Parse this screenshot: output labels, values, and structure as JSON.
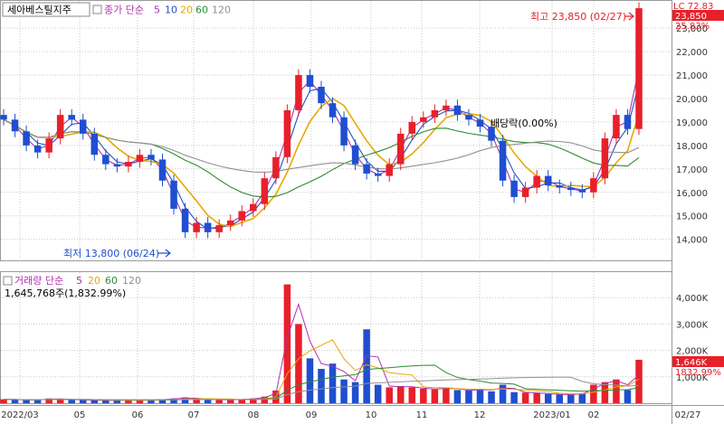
{
  "header": {
    "stock_name": "세아베스틸지주",
    "price_ma_label": "종가 단순",
    "ma_periods": [
      "5",
      "10",
      "20",
      "60",
      "120"
    ],
    "volume_label": "거래량 단순",
    "volume_ma_periods": [
      "5",
      "20",
      "60",
      "120"
    ],
    "volume_value_text": "1,645,768주(1,832.99%)"
  },
  "colors": {
    "up": "#e8202a",
    "down": "#1f4fd0",
    "ma5": "#b030b0",
    "ma10": "#2050c0",
    "ma20": "#e8a800",
    "ma60": "#2e8b2e",
    "ma120": "#909090",
    "grid": "#c8c8c8",
    "axis_text": "#333333"
  },
  "annotations": {
    "high_label": "최고 23,850 (02/27)",
    "low_label": "최저 13,800 (06/24)",
    "dividend_label": "배당락(0.00%)"
  },
  "right_labels": {
    "lc_label": "LC 72.83",
    "price_badge": "23,850",
    "price_pct": "25.83%",
    "volume_badge": "1,646K",
    "volume_pct": "1832.99%"
  },
  "chart_data": [
    {
      "type": "candlestick",
      "title": "",
      "x_tick_labels": [
        "2022/03",
        "05",
        "06",
        "07",
        "08",
        "09",
        "10",
        "11",
        "12",
        "2023/01",
        "02",
        "02/27"
      ],
      "y_tick_labels": [
        "14,000",
        "15,000",
        "16,000",
        "17,000",
        "18,000",
        "19,000",
        "20,000",
        "21,000",
        "22,000",
        "23,000"
      ],
      "y_ticks": [
        14000,
        15000,
        16000,
        17000,
        18000,
        19000,
        20000,
        21000,
        22000,
        23000
      ],
      "ylim": [
        13100,
        24200
      ],
      "close_series_weekly": [
        19100,
        18600,
        18000,
        17700,
        18300,
        19300,
        19100,
        18500,
        17600,
        17200,
        17100,
        17300,
        17600,
        17400,
        16500,
        15300,
        14300,
        14700,
        14300,
        14600,
        14800,
        15200,
        15500,
        16600,
        17500,
        19500,
        21000,
        20500,
        19800,
        19200,
        18000,
        17200,
        16800,
        16700,
        17200,
        18500,
        19000,
        19200,
        19500,
        19700,
        19300,
        19100,
        18800,
        18200,
        16500,
        15800,
        16200,
        16700,
        16300,
        16200,
        16100,
        16000,
        16600,
        18300,
        19300,
        18700,
        23850
      ],
      "low": {
        "value": 13800,
        "date": "06/24"
      },
      "high": {
        "value": 23850,
        "date": "02/27"
      }
    },
    {
      "type": "bar",
      "title": "",
      "y_tick_labels": [
        "1,000K",
        "2,000K",
        "3,000K",
        "4,000K"
      ],
      "y_ticks": [
        1000,
        2000,
        3000,
        4000
      ],
      "ylim": [
        0,
        5000
      ],
      "unit": "K shares",
      "volume_weekly": [
        150,
        130,
        120,
        130,
        180,
        150,
        130,
        120,
        110,
        100,
        110,
        120,
        110,
        120,
        150,
        180,
        220,
        160,
        140,
        130,
        130,
        150,
        180,
        250,
        480,
        4500,
        3000,
        1700,
        1300,
        1500,
        900,
        800,
        2800,
        700,
        600,
        650,
        600,
        550,
        520,
        600,
        500,
        480,
        550,
        450,
        700,
        420,
        400,
        380,
        350,
        330,
        320,
        380,
        700,
        800,
        900,
        500,
        1646
      ]
    }
  ]
}
